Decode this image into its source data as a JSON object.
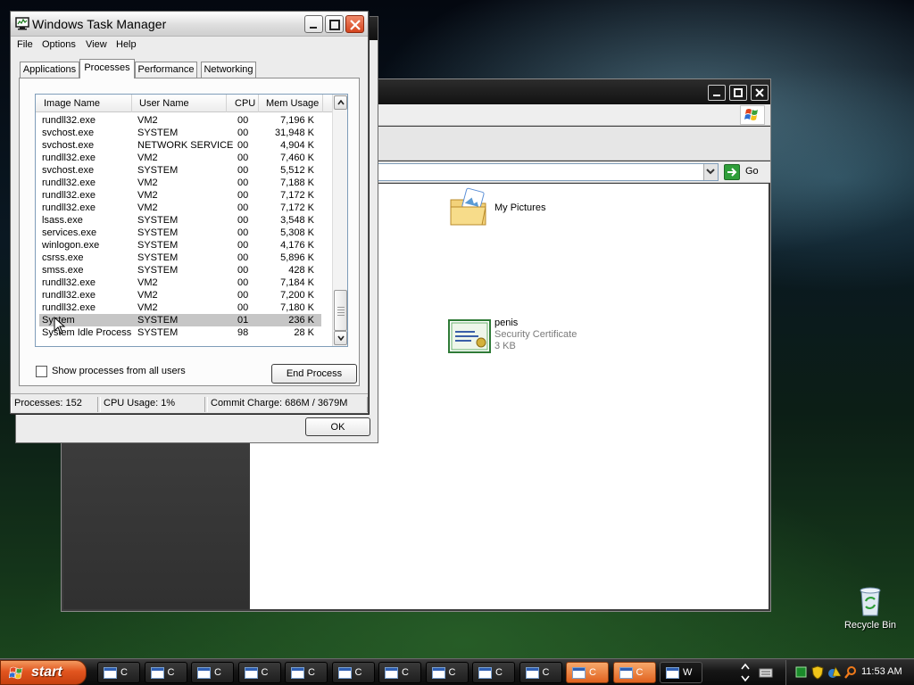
{
  "explorer": {
    "go_label": "Go",
    "files": [
      {
        "name": "My Pictures",
        "type": "",
        "size": ""
      },
      {
        "name": "penis",
        "type": "Security Certificate",
        "size": "3 KB"
      }
    ]
  },
  "propdialog": {
    "ok_label": "OK"
  },
  "taskmgr": {
    "title": "Windows Task Manager",
    "menu": [
      "File",
      "Options",
      "View",
      "Help"
    ],
    "tabs": [
      "Applications",
      "Processes",
      "Performance",
      "Networking"
    ],
    "active_tab": "Processes",
    "columns": [
      "Image Name",
      "User Name",
      "CPU",
      "Mem Usage"
    ],
    "rows": [
      {
        "image": "rundll32.exe",
        "user": "VM2",
        "cpu": "00",
        "mem": "7,196 K"
      },
      {
        "image": "svchost.exe",
        "user": "SYSTEM",
        "cpu": "00",
        "mem": "31,948 K"
      },
      {
        "image": "svchost.exe",
        "user": "NETWORK SERVICE",
        "cpu": "00",
        "mem": "4,904 K"
      },
      {
        "image": "rundll32.exe",
        "user": "VM2",
        "cpu": "00",
        "mem": "7,460 K"
      },
      {
        "image": "svchost.exe",
        "user": "SYSTEM",
        "cpu": "00",
        "mem": "5,512 K"
      },
      {
        "image": "rundll32.exe",
        "user": "VM2",
        "cpu": "00",
        "mem": "7,188 K"
      },
      {
        "image": "rundll32.exe",
        "user": "VM2",
        "cpu": "00",
        "mem": "7,172 K"
      },
      {
        "image": "rundll32.exe",
        "user": "VM2",
        "cpu": "00",
        "mem": "7,172 K"
      },
      {
        "image": "lsass.exe",
        "user": "SYSTEM",
        "cpu": "00",
        "mem": "3,548 K"
      },
      {
        "image": "services.exe",
        "user": "SYSTEM",
        "cpu": "00",
        "mem": "5,308 K"
      },
      {
        "image": "winlogon.exe",
        "user": "SYSTEM",
        "cpu": "00",
        "mem": "4,176 K"
      },
      {
        "image": "csrss.exe",
        "user": "SYSTEM",
        "cpu": "00",
        "mem": "5,896 K"
      },
      {
        "image": "smss.exe",
        "user": "SYSTEM",
        "cpu": "00",
        "mem": "428 K"
      },
      {
        "image": "rundll32.exe",
        "user": "VM2",
        "cpu": "00",
        "mem": "7,184 K"
      },
      {
        "image": "rundll32.exe",
        "user": "VM2",
        "cpu": "00",
        "mem": "7,200 K"
      },
      {
        "image": "rundll32.exe",
        "user": "VM2",
        "cpu": "00",
        "mem": "7,180 K"
      },
      {
        "image": "System",
        "user": "SYSTEM",
        "cpu": "01",
        "mem": "236 K",
        "selected": true
      },
      {
        "image": "System Idle Process",
        "user": "SYSTEM",
        "cpu": "98",
        "mem": "28 K"
      }
    ],
    "show_all_label": "Show processes from all users",
    "show_all_checked": false,
    "end_process_label": "End Process",
    "status": {
      "processes": "Processes: 152",
      "cpu": "CPU Usage: 1%",
      "commit": "Commit Charge: 686M / 3679M"
    }
  },
  "desktop": {
    "recycle_bin_label": "Recycle Bin"
  },
  "taskbar": {
    "start_label": "start",
    "buttons": [
      {
        "label": "C",
        "style": "normal"
      },
      {
        "label": "C",
        "style": "normal"
      },
      {
        "label": "C",
        "style": "normal"
      },
      {
        "label": "C",
        "style": "normal"
      },
      {
        "label": "C",
        "style": "normal"
      },
      {
        "label": "C",
        "style": "normal"
      },
      {
        "label": "C",
        "style": "normal"
      },
      {
        "label": "C",
        "style": "normal"
      },
      {
        "label": "C",
        "style": "normal"
      },
      {
        "label": "C",
        "style": "normal"
      },
      {
        "label": "C",
        "style": "orange"
      },
      {
        "label": "C",
        "style": "orange"
      },
      {
        "label": "W",
        "style": "dark"
      }
    ],
    "clock": "11:53 AM"
  }
}
